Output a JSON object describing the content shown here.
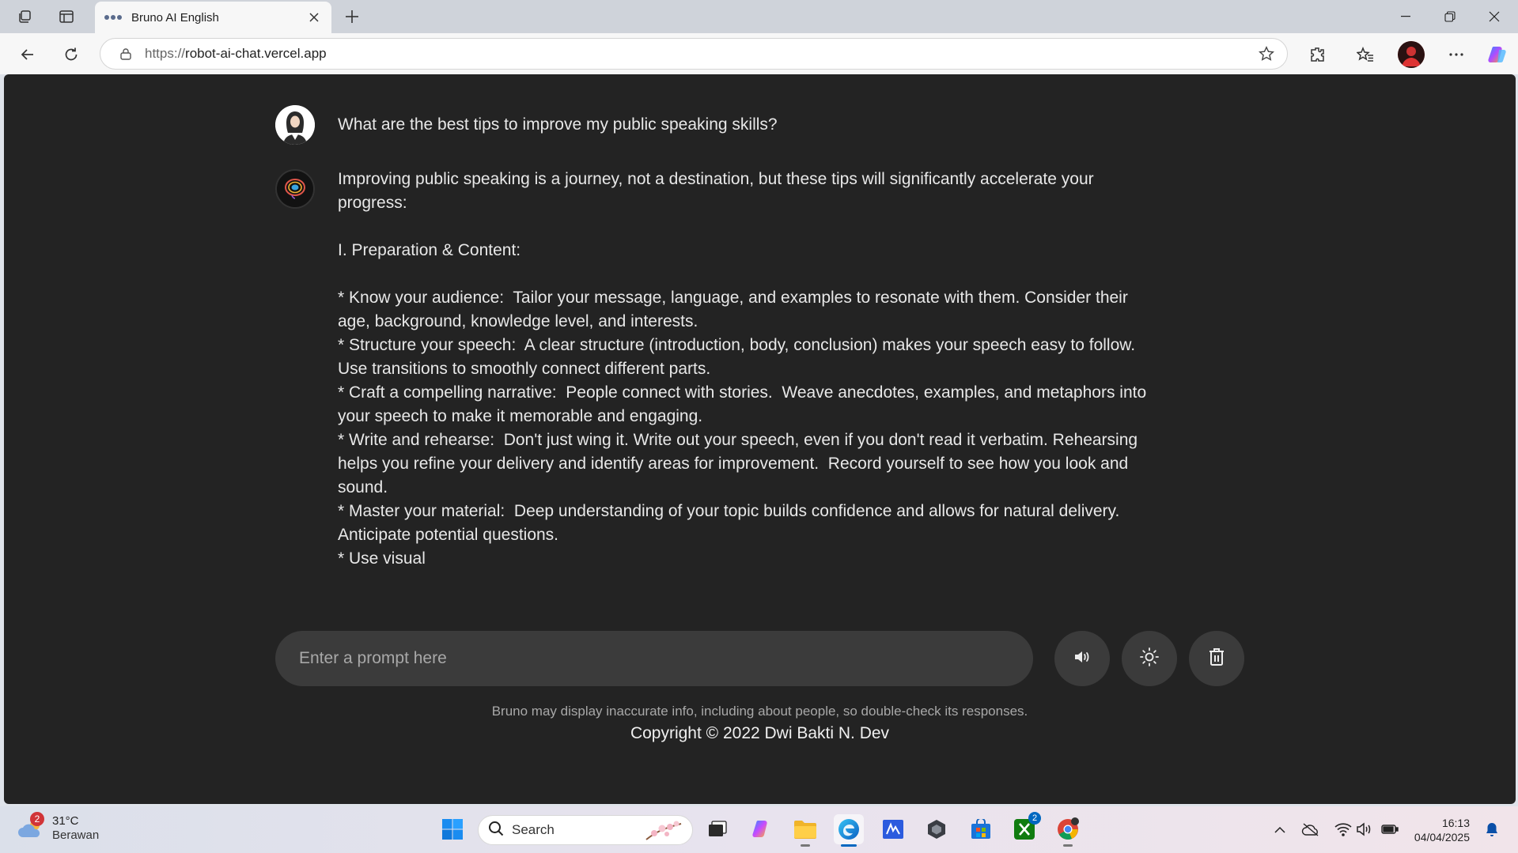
{
  "browser": {
    "tab_title": "Bruno AI English",
    "url_scheme": "https://",
    "url_host": "robot-ai-chat.vercel.app"
  },
  "chat": {
    "user_question": "What are the best tips to improve my public speaking skills?",
    "bot_answer": "Improving public speaking is a journey, not a destination, but these tips will significantly accelerate your progress:\n\nI. Preparation & Content:\n\n* Know your audience:  Tailor your message, language, and examples to resonate with them. Consider their age, background, knowledge level, and interests.\n* Structure your speech:  A clear structure (introduction, body, conclusion) makes your speech easy to follow. Use transitions to smoothly connect different parts.\n* Craft a compelling narrative:  People connect with stories.  Weave anecdotes, examples, and metaphors into your speech to make it memorable and engaging.\n* Write and rehearse:  Don't just wing it. Write out your speech, even if you don't read it verbatim. Rehearsing helps you refine your delivery and identify areas for improvement.  Record yourself to see how you look and sound.\n* Master your material:  Deep understanding of your topic builds confidence and allows for natural delivery.  Anticipate potential questions.\n* Use visual"
  },
  "prompt": {
    "placeholder": "Enter a prompt here",
    "value": ""
  },
  "controls": {
    "speaker_icon": "speaker-icon",
    "theme_icon": "sun-icon",
    "delete_icon": "trash-icon"
  },
  "footer": {
    "disclaimer": "Bruno may display inaccurate info, including about people, so double-check its responses.",
    "copyright": "Copyright © 2022 Dwi Bakti N. Dev"
  },
  "taskbar": {
    "weather_badge": "2",
    "weather_temp": "31°C",
    "weather_desc": "Berawan",
    "search_label": "Search",
    "xbox_badge": "2",
    "time": "16:13",
    "date": "04/04/2025"
  },
  "colors": {
    "page_bg": "#232323",
    "input_bg": "#3b3b3b",
    "text": "#e8e8e8",
    "muted": "#a8a8a8",
    "accent": "#0067c0"
  }
}
